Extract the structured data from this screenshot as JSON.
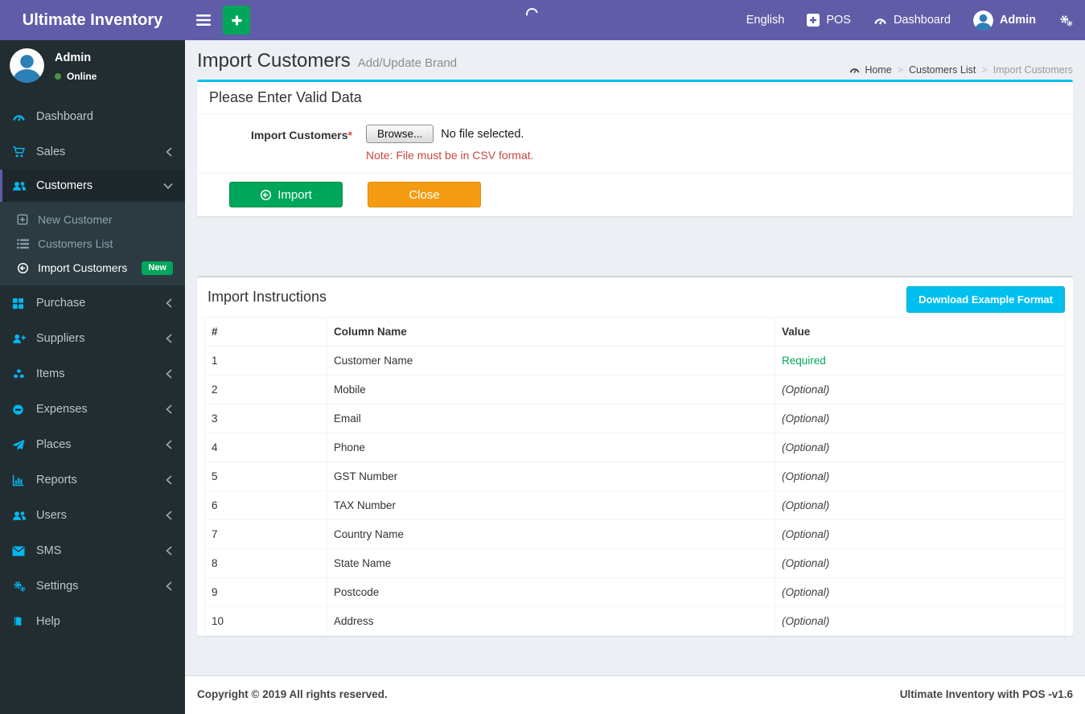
{
  "app": {
    "brand": "Ultimate Inventory",
    "footer_left": "Copyright © 2019 All rights reserved.",
    "footer_right": "Ultimate Inventory with POS -v1.6"
  },
  "navbar": {
    "language": "English",
    "pos_label": "POS",
    "dashboard_label": "Dashboard",
    "user_label": "Admin",
    "icons": {
      "toggle": "bars-icon",
      "quick_add": "plus-icon",
      "pos": "plus-square-icon",
      "dashboard": "dashboard-icon",
      "user": "user-avatar",
      "settings": "cogs-icon",
      "loading": "spinner"
    }
  },
  "sidebar": {
    "user": {
      "name": "Admin",
      "status": "Online"
    },
    "items": [
      {
        "label": "Dashboard",
        "icon": "dashboard-icon"
      },
      {
        "label": "Sales",
        "icon": "cart-icon",
        "chevron": "left"
      },
      {
        "label": "Customers",
        "icon": "users-icon",
        "chevron": "down",
        "active": true,
        "children": [
          {
            "label": "New Customer",
            "icon": "plus-square-outline-icon"
          },
          {
            "label": "Customers List",
            "icon": "list-icon"
          },
          {
            "label": "Import Customers",
            "icon": "import-circle-icon",
            "active": true,
            "badge": "New"
          }
        ]
      },
      {
        "label": "Purchase",
        "icon": "grid-icon",
        "chevron": "left"
      },
      {
        "label": "Suppliers",
        "icon": "user-plus-icon",
        "chevron": "left"
      },
      {
        "label": "Items",
        "icon": "cubes-icon",
        "chevron": "left"
      },
      {
        "label": "Expenses",
        "icon": "minus-circle-icon",
        "chevron": "left"
      },
      {
        "label": "Places",
        "icon": "paper-plane-icon",
        "chevron": "left"
      },
      {
        "label": "Reports",
        "icon": "bar-chart-icon",
        "chevron": "left"
      },
      {
        "label": "Users",
        "icon": "users-icon",
        "chevron": "left"
      },
      {
        "label": "SMS",
        "icon": "envelope-icon",
        "chevron": "left"
      },
      {
        "label": "Settings",
        "icon": "cogs-icon",
        "chevron": "left"
      },
      {
        "label": "Help",
        "icon": "book-icon"
      }
    ]
  },
  "page": {
    "title": "Import Customers",
    "subtitle": "Add/Update Brand",
    "breadcrumb": [
      {
        "label": "Home",
        "icon": "dashboard-icon",
        "current": false
      },
      {
        "label": "Customers List",
        "current": false
      },
      {
        "label": "Import Customers",
        "current": true
      }
    ]
  },
  "form": {
    "panel_title": "Please Enter Valid Data",
    "field_label": "Import Customers",
    "required_mark": "*",
    "browse_label": "Browse...",
    "file_status": "No file selected.",
    "note": "Note: File must be in CSV format.",
    "import_button": "Import",
    "close_button": "Close"
  },
  "instructions": {
    "panel_title": "Import Instructions",
    "download_button": "Download Example Format",
    "table": {
      "headers": [
        "#",
        "Column Name",
        "Value"
      ],
      "rows": [
        {
          "num": "1",
          "column": "Customer Name",
          "value": "Required",
          "required": true
        },
        {
          "num": "2",
          "column": "Mobile",
          "value": "(Optional)",
          "required": false
        },
        {
          "num": "3",
          "column": "Email",
          "value": "(Optional)",
          "required": false
        },
        {
          "num": "4",
          "column": "Phone",
          "value": "(Optional)",
          "required": false
        },
        {
          "num": "5",
          "column": "GST Number",
          "value": "(Optional)",
          "required": false
        },
        {
          "num": "6",
          "column": "TAX Number",
          "value": "(Optional)",
          "required": false
        },
        {
          "num": "7",
          "column": "Country Name",
          "value": "(Optional)",
          "required": false
        },
        {
          "num": "8",
          "column": "State Name",
          "value": "(Optional)",
          "required": false
        },
        {
          "num": "9",
          "column": "Postcode",
          "value": "(Optional)",
          "required": false
        },
        {
          "num": "10",
          "column": "Address",
          "value": "(Optional)",
          "required": false
        }
      ]
    }
  },
  "colors": {
    "navbar": "#605ca8",
    "sidebar": "#222d32",
    "submenu": "#2c3b41",
    "accent_info": "#00c0ef",
    "icon_cyan": "#00b8ef",
    "success_green": "#00a65a",
    "warning_orange": "#f39c12",
    "note_red": "#c9473c",
    "content_bg": "#ecf0f5"
  }
}
